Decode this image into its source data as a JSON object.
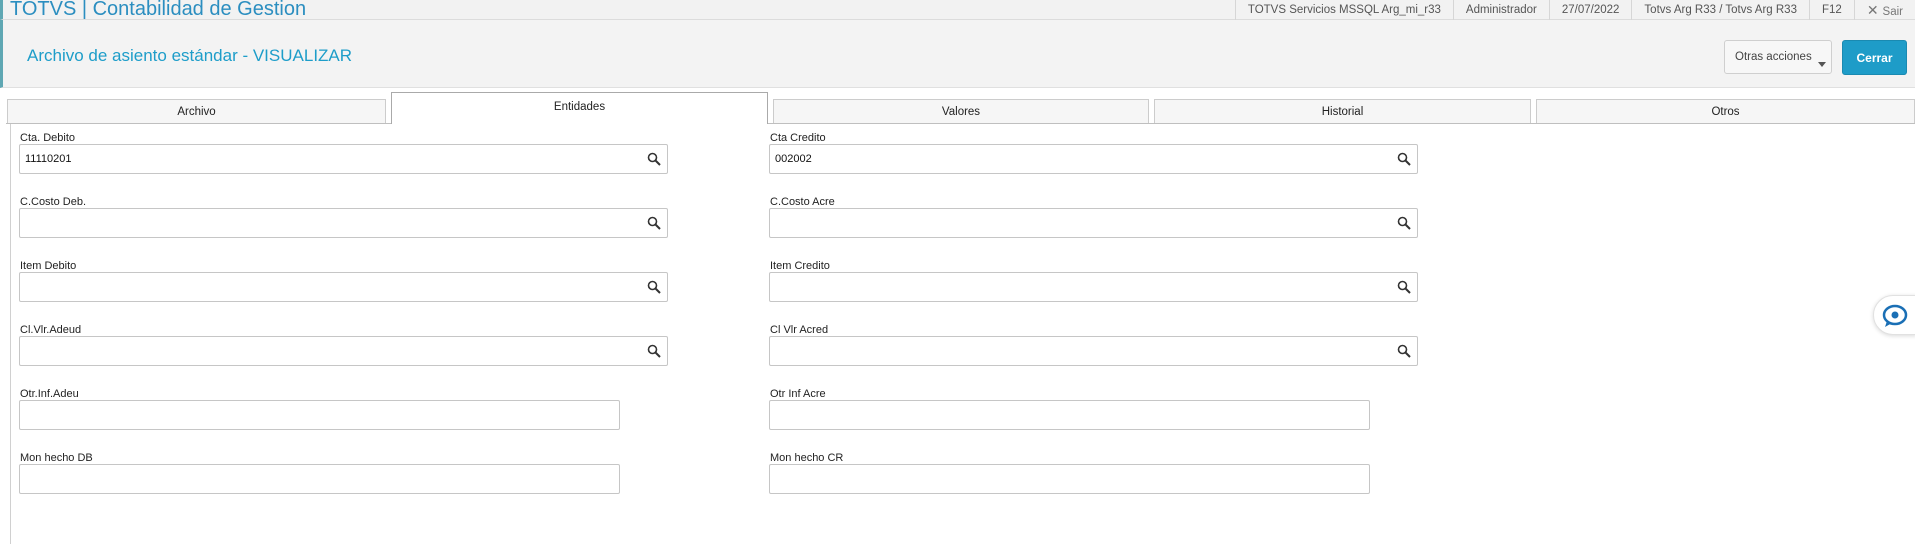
{
  "app": {
    "title": "TOTVS | Contabilidad de Gestion"
  },
  "topbar": {
    "items": [
      {
        "label": "TOTVS Servicios MSSQL Arg_mi_r33"
      },
      {
        "label": "Administrador"
      },
      {
        "label": "27/07/2022"
      },
      {
        "label": "Totvs Arg R33 / Totvs Arg R33"
      },
      {
        "label": "F12"
      }
    ],
    "exit_label": "Sair",
    "exit_icon": "close-icon"
  },
  "header": {
    "title": "Archivo de asiento estándar - VISUALIZAR",
    "otras_label": "Otras acciones",
    "cerrar_label": "Cerrar"
  },
  "tabs": [
    {
      "label": "Archivo"
    },
    {
      "label": "Entidades",
      "active": true
    },
    {
      "label": "Valores"
    },
    {
      "label": "Historial"
    },
    {
      "label": "Otros"
    }
  ],
  "form": {
    "left": [
      {
        "label": "Cta. Debito",
        "value": "11110201",
        "search": true
      },
      {
        "label": "C.Costo Deb.",
        "value": "",
        "search": true
      },
      {
        "label": "Item Debito",
        "value": "",
        "search": true
      },
      {
        "label": "Cl.Vlr.Adeud",
        "value": "",
        "search": true
      },
      {
        "label": "Otr.Inf.Adeu",
        "value": "",
        "search": false
      },
      {
        "label": "Mon hecho DB",
        "value": "",
        "search": false
      }
    ],
    "right": [
      {
        "label": "Cta Credito",
        "value": "002002",
        "search": true
      },
      {
        "label": "C.Costo Acre",
        "value": "",
        "search": true
      },
      {
        "label": "Item Credito",
        "value": "",
        "search": true
      },
      {
        "label": "Cl Vlr Acred",
        "value": "",
        "search": true
      },
      {
        "label": "Otr Inf Acre",
        "value": "",
        "search": false
      },
      {
        "label": "Mon hecho CR",
        "value": "",
        "search": false
      }
    ]
  },
  "colors": {
    "accent": "#1e9cc8",
    "title": "#2b8ec0",
    "side_border": "#5fa7b3"
  }
}
